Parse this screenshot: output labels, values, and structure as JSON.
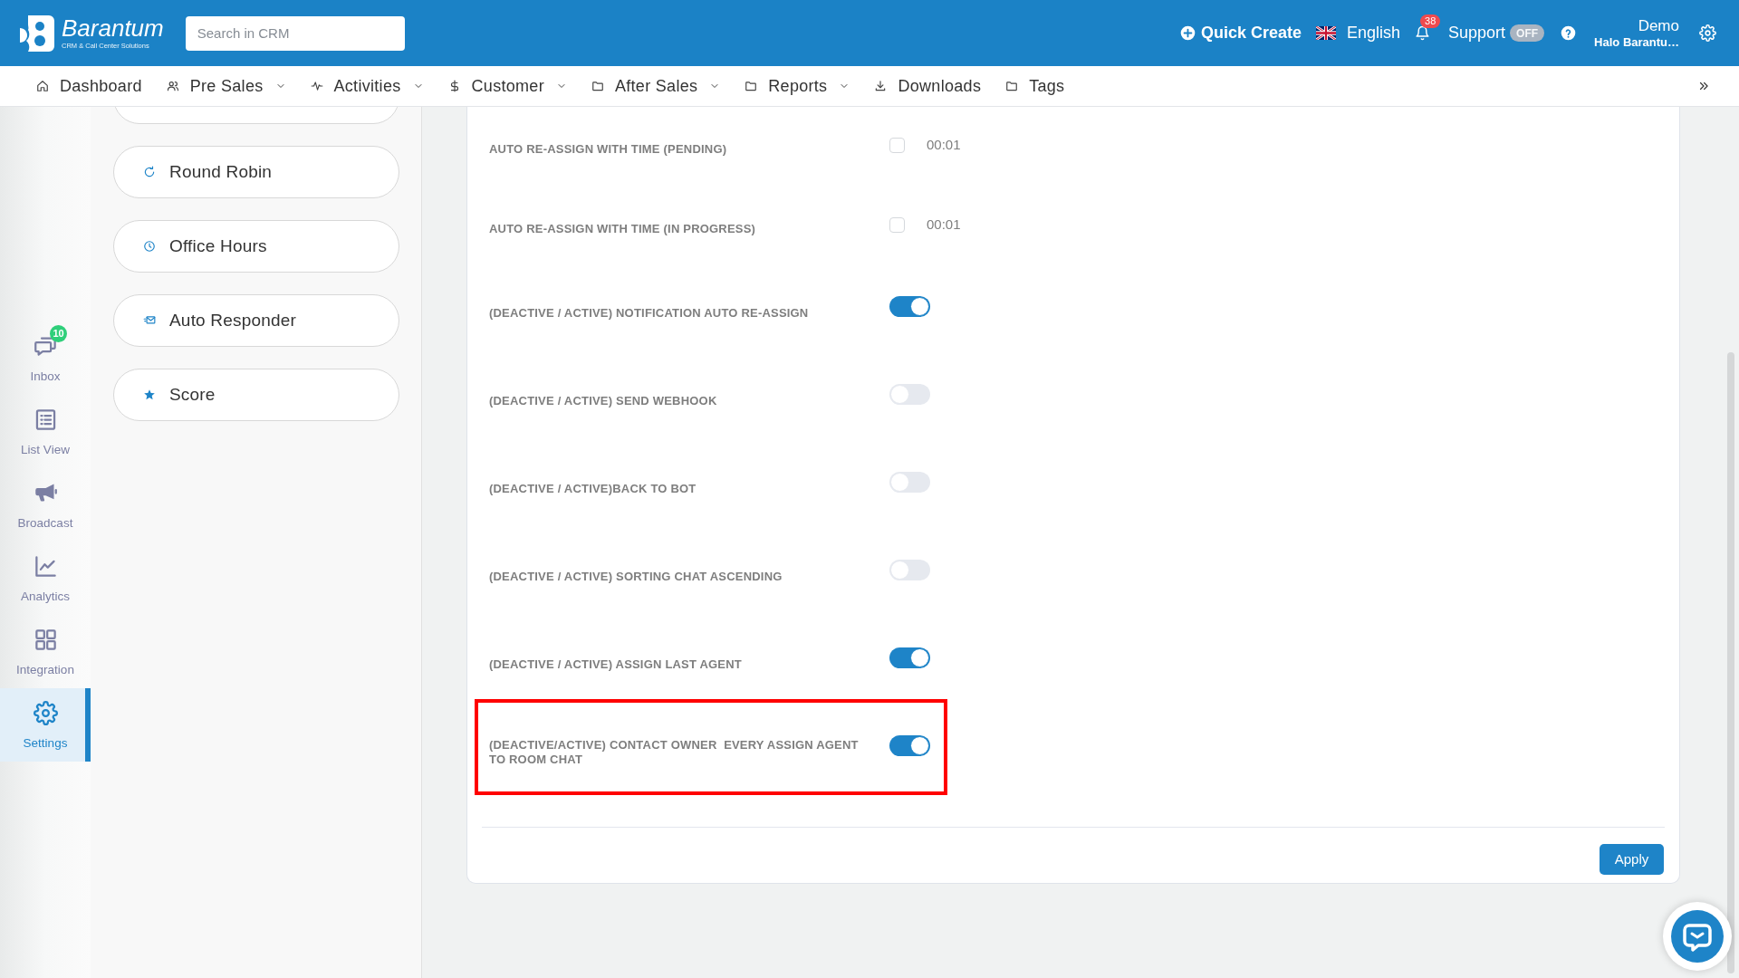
{
  "header": {
    "brand": {
      "name": "Barantum",
      "tagline": "CRM & Call Center Solutions"
    },
    "search": {
      "placeholder": "Search in CRM"
    },
    "quick_create": "Quick Create",
    "language": "English",
    "notifications": {
      "count": "38"
    },
    "support": {
      "label": "Support",
      "status": "OFF",
      "on": false
    },
    "user": {
      "name": "Demo",
      "company": "Halo Barantu…"
    }
  },
  "nav": {
    "items": [
      {
        "label": "Dashboard",
        "has_menu": false
      },
      {
        "label": "Pre Sales",
        "has_menu": true
      },
      {
        "label": "Activities",
        "has_menu": true
      },
      {
        "label": "Customer",
        "has_menu": true
      },
      {
        "label": "After Sales",
        "has_menu": true
      },
      {
        "label": "Reports",
        "has_menu": true
      },
      {
        "label": "Downloads",
        "has_menu": false
      },
      {
        "label": "Tags",
        "has_menu": false
      }
    ]
  },
  "sidebar": {
    "items": [
      {
        "label": "Inbox",
        "badge": "10",
        "selected": false
      },
      {
        "label": "List View",
        "selected": false
      },
      {
        "label": "Broadcast",
        "selected": false
      },
      {
        "label": "Analytics",
        "selected": false
      },
      {
        "label": "Integration",
        "selected": false
      },
      {
        "label": "Settings",
        "selected": true
      }
    ]
  },
  "settings_menu": {
    "items": [
      {
        "label": "Round Robin"
      },
      {
        "label": "Office Hours"
      },
      {
        "label": "Auto Responder"
      },
      {
        "label": "Score"
      }
    ]
  },
  "settings": {
    "rows": [
      {
        "kind": "timer",
        "label": "AUTO RE-ASSIGN WITH TIME (PENDING)",
        "checked": false,
        "value": "00:01",
        "highlighted": false
      },
      {
        "kind": "timer",
        "label": "AUTO RE-ASSIGN WITH TIME (IN PROGRESS)",
        "checked": false,
        "value": "00:01",
        "highlighted": false
      },
      {
        "kind": "toggle",
        "label": "(DEACTIVE / ACTIVE) NOTIFICATION AUTO RE-ASSIGN",
        "on": true,
        "highlighted": false
      },
      {
        "kind": "toggle",
        "label": "(DEACTIVE / ACTIVE) SEND WEBHOOK",
        "on": false,
        "highlighted": false
      },
      {
        "kind": "toggle",
        "label": "(DEACTIVE / ACTIVE)BACK TO BOT",
        "on": false,
        "highlighted": false
      },
      {
        "kind": "toggle",
        "label": "(DEACTIVE / ACTIVE) SORTING CHAT ASCENDING",
        "on": false,
        "highlighted": false
      },
      {
        "kind": "toggle",
        "label": "(DEACTIVE / ACTIVE) ASSIGN LAST AGENT",
        "on": true,
        "highlighted": false
      },
      {
        "kind": "toggle",
        "label": "(DEACTIVE/ACTIVE) CONTACT OWNER  EVERY ASSIGN AGENT TO ROOM CHAT",
        "on": true,
        "highlighted": true
      }
    ],
    "apply_button": "Apply"
  }
}
